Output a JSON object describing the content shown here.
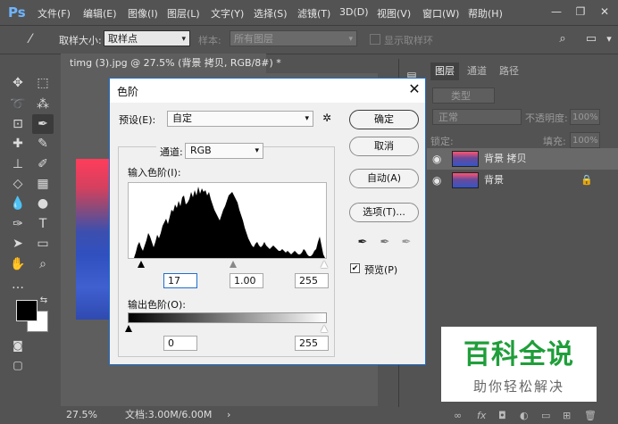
{
  "app": {
    "logo": "Ps"
  },
  "menubar": {
    "items": [
      "文件(F)",
      "编辑(E)",
      "图像(I)",
      "图层(L)",
      "文字(Y)",
      "选择(S)",
      "滤镜(T)",
      "3D(D)",
      "视图(V)",
      "窗口(W)",
      "帮助(H)"
    ],
    "window_controls": {
      "minimize": "—",
      "restore": "❐",
      "close": "✕"
    }
  },
  "options_bar": {
    "sample_size_label": "取样大小:",
    "sample_size_value": "取样点",
    "sample_label": "样本:",
    "sample_value": "所有图层",
    "show_ring_label": "显示取样环"
  },
  "document": {
    "tab_title": "timg (3).jpg @ 27.5% (背景 拷贝, RGB/8#) *",
    "tab_close": "✕",
    "zoom": "27.5%",
    "doc_size": "文档:3.00M/6.00M"
  },
  "layers_panel": {
    "tabs": [
      "图层",
      "通道",
      "路径"
    ],
    "filter_kind": "类型",
    "blend_mode": "正常",
    "opacity_label": "不透明度:",
    "opacity_value": "100%",
    "lock_label": "锁定:",
    "fill_label": "填充:",
    "fill_value": "100%",
    "layers": [
      {
        "name": "背景 拷贝",
        "visible": true,
        "selected": true
      },
      {
        "name": "背景",
        "visible": true,
        "locked": true
      }
    ],
    "bottom_icons": [
      "link-icon",
      "fx-icon",
      "mask-icon",
      "adjustment-icon",
      "group-icon",
      "new-layer-icon",
      "trash-icon"
    ],
    "fx_text": "fx"
  },
  "levels_dialog": {
    "title": "色阶",
    "close": "✕",
    "preset_label": "预设(E):",
    "preset_value": "自定",
    "channel_label": "通道:",
    "channel_value": "RGB",
    "input_levels_label": "输入色阶(I):",
    "input_black": "17",
    "input_gamma": "1.00",
    "input_white": "255",
    "output_levels_label": "输出色阶(O):",
    "output_black": "0",
    "output_white": "255",
    "buttons": {
      "ok": "确定",
      "cancel": "取消",
      "auto": "自动(A)",
      "options": "选项(T)..."
    },
    "preview_label": "预览(P)",
    "preview_checked": true
  },
  "watermark": {
    "title": "百科全说",
    "subtitle": "助你轻松解决"
  }
}
